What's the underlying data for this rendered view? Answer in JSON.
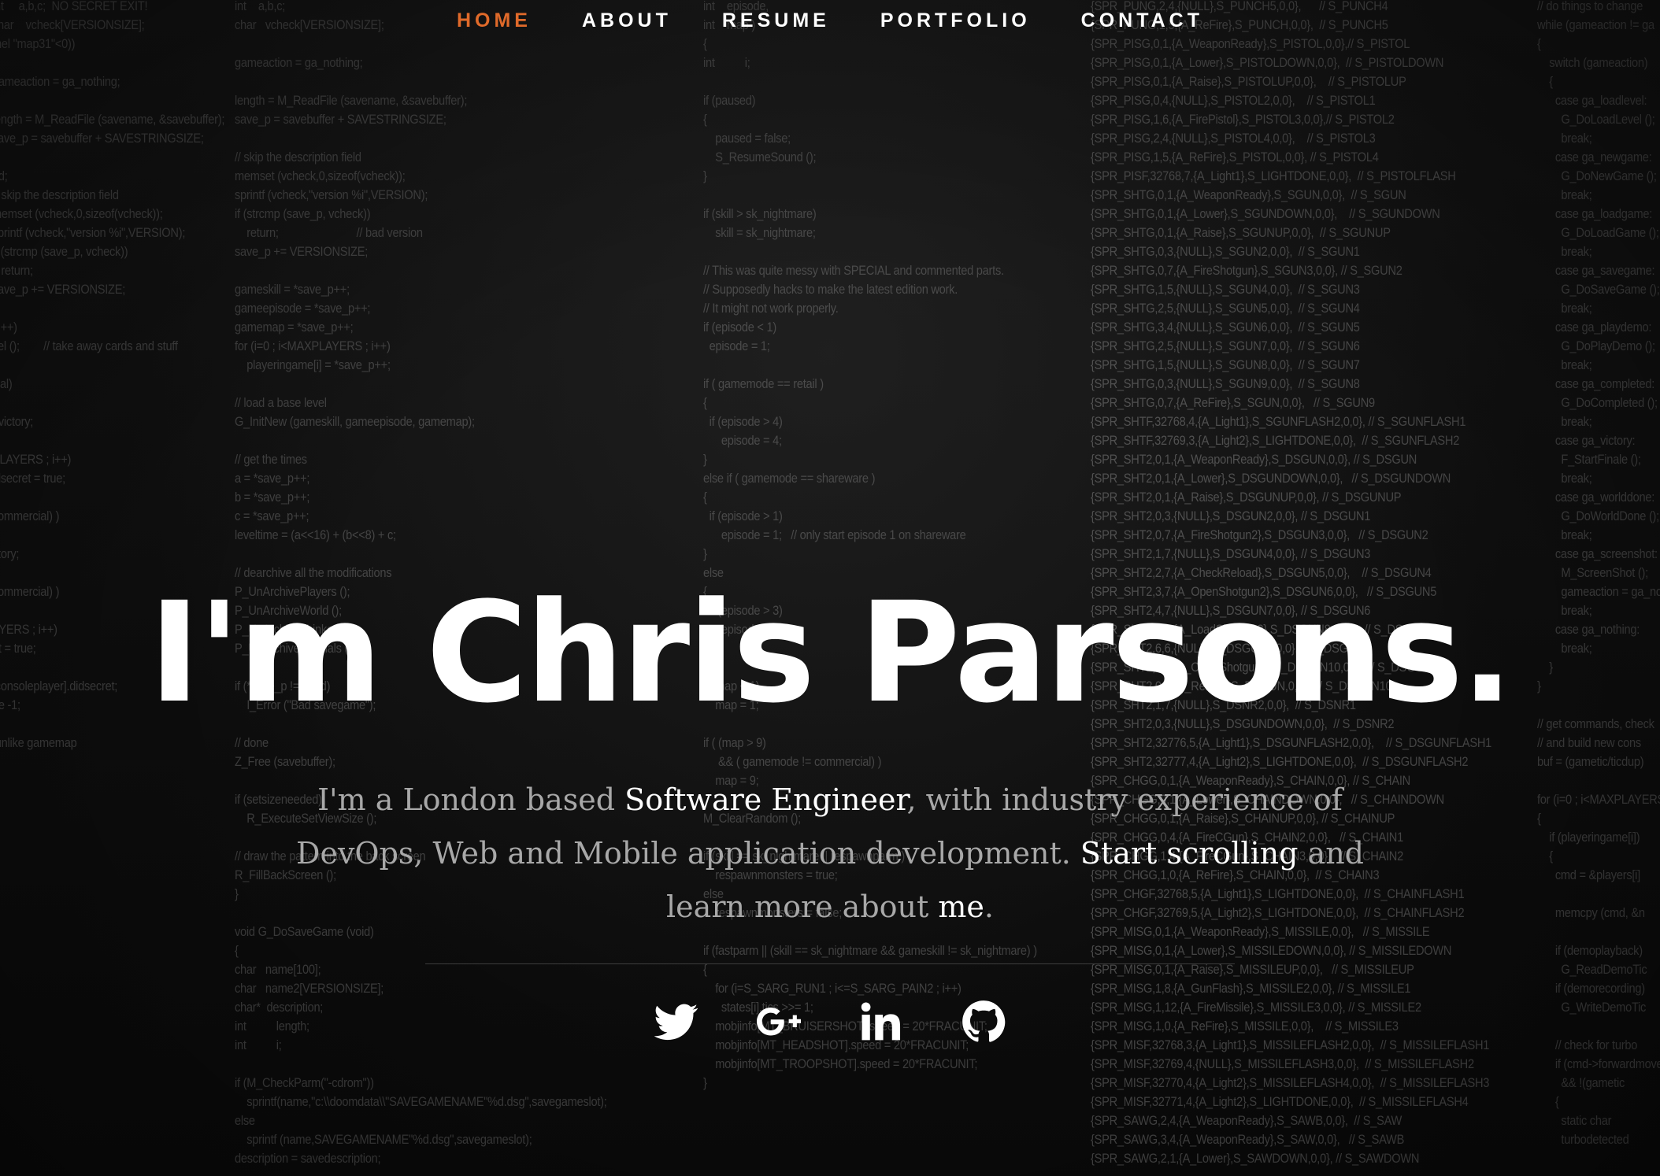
{
  "nav": {
    "items": [
      {
        "label": "HOME",
        "active": true
      },
      {
        "label": "ABOUT",
        "active": false
      },
      {
        "label": "RESUME",
        "active": false
      },
      {
        "label": "PORTFOLIO",
        "active": false
      },
      {
        "label": "CONTACT",
        "active": false
      }
    ]
  },
  "colors": {
    "accent": "#e06a2a",
    "text_primary": "#ffffff",
    "text_muted": "#a8a8a8",
    "background": "#0d0d0d"
  },
  "hero": {
    "title": "I'm Chris Parsons.",
    "text_parts": [
      {
        "text": "I'm a London based ",
        "highlight": false
      },
      {
        "text": "Software Engineer",
        "highlight": true
      },
      {
        "text": ", with industry experience of DevOps, Web and Mobile application development. ",
        "highlight": false
      },
      {
        "text": "Start scrolling",
        "highlight": true
      },
      {
        "text": " and learn more about ",
        "highlight": false
      },
      {
        "text": "me",
        "highlight": true
      },
      {
        "text": ".",
        "highlight": false
      }
    ]
  },
  "social": [
    {
      "name": "twitter-icon"
    },
    {
      "name": "google-plus-icon"
    },
    {
      "name": "linkedin-icon"
    },
    {
      "name": "github-icon"
    }
  ]
}
